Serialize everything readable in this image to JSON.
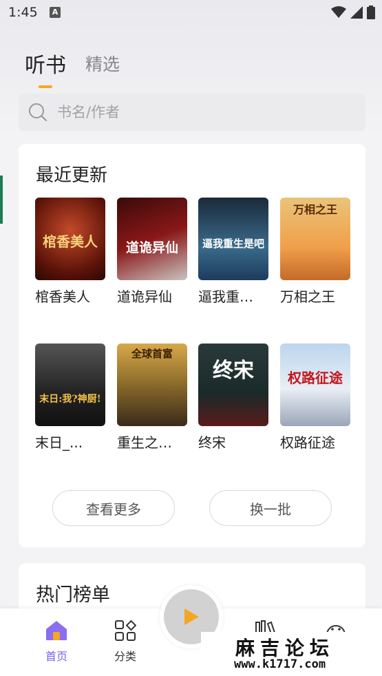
{
  "status_bar": {
    "time": "1:45",
    "notif_letter": "A"
  },
  "tabs": [
    {
      "label": "听书"
    },
    {
      "label": "精选"
    }
  ],
  "search": {
    "placeholder": "书名/作者"
  },
  "recent": {
    "title": "最近更新",
    "books": [
      {
        "title": "棺香美人",
        "cover_text": "棺香美人"
      },
      {
        "title": "道诡异仙",
        "cover_text": "道诡异仙"
      },
      {
        "title": "逼我重…",
        "cover_text": "逼我重生是吧"
      },
      {
        "title": "万相之王",
        "cover_text": "万相之王"
      },
      {
        "title": "末日_...",
        "cover_text": "末日:我?神厨!"
      },
      {
        "title": "重生之…",
        "cover_text": "全球首富"
      },
      {
        "title": "终宋",
        "cover_text": "终宋"
      },
      {
        "title": "权路征途",
        "cover_text": "权路征途"
      }
    ],
    "more_button": "查看更多",
    "refresh_button": "换一批"
  },
  "hot": {
    "title": "热门榜单"
  },
  "nav": {
    "home": "首页",
    "category": "分类"
  },
  "watermark": {
    "name": "麻吉论坛",
    "url": "www.k1717.com"
  },
  "colors": {
    "accent": "#f5a623",
    "active_nav": "#7b5cf0"
  }
}
